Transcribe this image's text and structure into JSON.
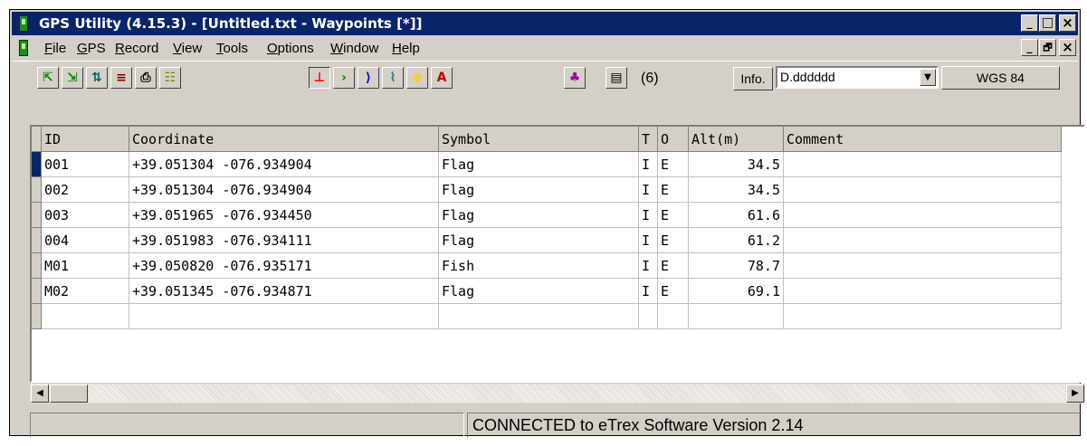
{
  "window": {
    "title": "GPS Utility (4.15.3) - [Untitled.txt - Waypoints [*]]",
    "controls": {
      "minimize": "_",
      "maximize": "□",
      "close": "×",
      "restore": "🗗"
    }
  },
  "menubar": {
    "items": [
      "File",
      "GPS",
      "Record",
      "View",
      "Tools",
      "Options",
      "Window",
      "Help"
    ],
    "mdi_controls": {
      "minimize": "_",
      "restore": "🗗",
      "close": "×"
    }
  },
  "toolbar": {
    "buttons": [
      {
        "icon": "open-waypoint-icon",
        "glyph": "⇱",
        "color": "#008000"
      },
      {
        "icon": "open-track-icon",
        "glyph": "⇲",
        "color": "#008000"
      },
      {
        "icon": "download-icon",
        "glyph": "⇅",
        "color": "#006060"
      },
      {
        "icon": "upload-icon",
        "glyph": "≡",
        "color": "#800000"
      },
      {
        "icon": "print-icon",
        "glyph": "⎙",
        "color": "#000000"
      },
      {
        "icon": "properties-icon",
        "glyph": "☷",
        "color": "#808000"
      },
      {
        "icon": "waypoints-icon",
        "glyph": "⊥",
        "color": "#ff0000",
        "pressed": true
      },
      {
        "icon": "routes-icon",
        "glyph": "›",
        "color": "#008000"
      },
      {
        "icon": "tracks-icon",
        "glyph": "⟩",
        "color": "#0000ff"
      },
      {
        "icon": "map-icon",
        "glyph": "⌇",
        "color": "#008080"
      },
      {
        "icon": "target-icon",
        "glyph": "⊕",
        "color": "#ffcc00"
      },
      {
        "icon": "text-icon",
        "glyph": "A",
        "color": "#c00000"
      },
      {
        "icon": "color-map-icon",
        "glyph": "♣",
        "color": "#a000a0"
      },
      {
        "icon": "list-icon",
        "glyph": "▤",
        "color": "#000000"
      }
    ],
    "count": "(6)",
    "info_label": "Info.",
    "format_value": "D.dddddd",
    "datum_label": "WGS 84"
  },
  "grid": {
    "columns": [
      "ID",
      "Coordinate",
      "Symbol",
      "T",
      "O",
      "Alt(m)",
      "Comment"
    ],
    "rows": [
      {
        "id": "001",
        "coordinate": "+39.051304 -076.934904",
        "symbol": "Flag",
        "t": "I",
        "o": "E",
        "alt": "34.5",
        "comment": ""
      },
      {
        "id": "002",
        "coordinate": "+39.051304 -076.934904",
        "symbol": "Flag",
        "t": "I",
        "o": "E",
        "alt": "34.5",
        "comment": ""
      },
      {
        "id": "003",
        "coordinate": "+39.051965 -076.934450",
        "symbol": "Flag",
        "t": "I",
        "o": "E",
        "alt": "61.6",
        "comment": ""
      },
      {
        "id": "004",
        "coordinate": "+39.051983 -076.934111",
        "symbol": "Flag",
        "t": "I",
        "o": "E",
        "alt": "61.2",
        "comment": ""
      },
      {
        "id": "M01",
        "coordinate": "+39.050820 -076.935171",
        "symbol": "Fish",
        "t": "I",
        "o": "E",
        "alt": "78.7",
        "comment": ""
      },
      {
        "id": "M02",
        "coordinate": "+39.051345 -076.934871",
        "symbol": "Flag",
        "t": "I",
        "o": "E",
        "alt": "69.1",
        "comment": ""
      }
    ]
  },
  "scrollbar": {
    "left_arrow": "◀",
    "right_arrow": "▶"
  },
  "status": {
    "connection": "CONNECTED to eTrex Software Version 2.14"
  },
  "colors": {
    "titlebar": "#0a246a",
    "face": "#d4d0c8",
    "selection": "#0a246a"
  }
}
